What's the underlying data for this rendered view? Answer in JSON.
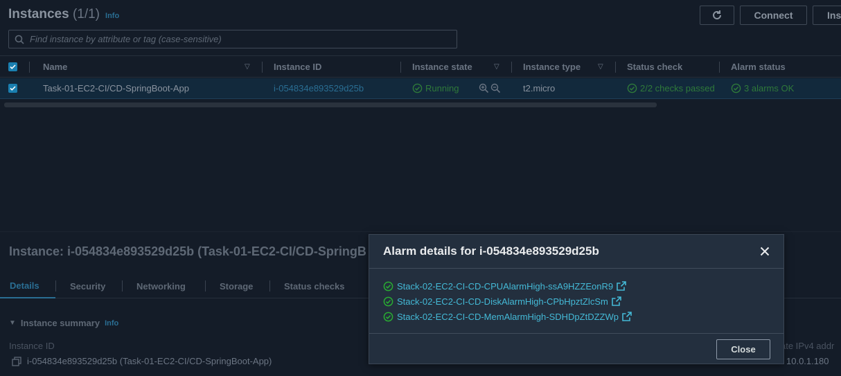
{
  "instances_panel": {
    "title": "Instances",
    "count": "(1/1)",
    "info": "Info",
    "connect_label": "Connect",
    "launch_label_partial": "Ins",
    "search_placeholder": "Find instance by attribute or tag (case-sensitive)",
    "columns": [
      "Name",
      "Instance ID",
      "Instance state",
      "Instance type",
      "Status check",
      "Alarm status"
    ],
    "row": {
      "name": "Task-01-EC2-CI/CD-SpringBoot-App",
      "instance_id": "i-054834e893529d25b",
      "state": "Running",
      "type": "t2.micro",
      "status_check": "2/2 checks passed",
      "alarm_status": "3 alarms OK"
    }
  },
  "detail_panel": {
    "title": "Instance: i-054834e893529d25b (Task-01-EC2-CI/CD-SpringB",
    "tabs": [
      "Details",
      "Security",
      "Networking",
      "Storage",
      "Status checks"
    ],
    "summary_heading": "Instance summary",
    "summary_info": "Info",
    "instance_id_label": "Instance ID",
    "instance_id_value": "i-054834e893529d25b (Task-01-EC2-CI/CD-SpringBoot-App)",
    "private_ip_label_partial": "ate IPv4 addr",
    "private_ip_value_partial": "10.0.1.180"
  },
  "modal": {
    "title": "Alarm details for i-054834e893529d25b",
    "alarms": [
      "Stack-02-EC2-CI-CD-CPUAlarmHigh-ssA9HZZEonR9",
      "Stack-02-EC2-CI-CD-DiskAlarmHigh-CPbHpztZlcSm",
      "Stack-02-EC2-CI-CD-MemAlarmHigh-SDHDpZtDZZWp"
    ],
    "close_label": "Close"
  },
  "colors": {
    "link": "#44b9d6",
    "success": "#29ad32",
    "selected_row": "#12293c"
  }
}
